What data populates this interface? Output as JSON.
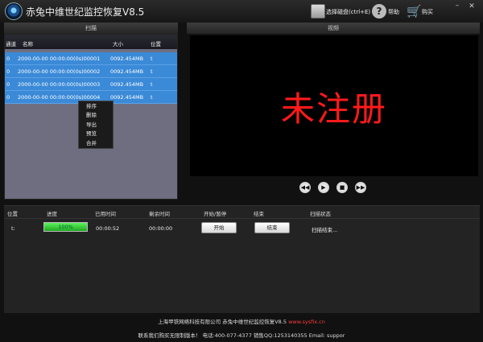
{
  "app": {
    "title": "赤兔中维世纪监控恢复V8.5",
    "select_disk_label": "选择磁盘(ctrl+E)",
    "help_label": "帮助",
    "buy_label": "购买",
    "min_label": "–",
    "close_label": "✕"
  },
  "scan": {
    "header": "扫描",
    "columns": {
      "channel": "通道",
      "name": "名称",
      "size": "大小",
      "location": "位置"
    },
    "rows": [
      {
        "channel": "0",
        "name": "2000-00-00 00:00:00(0s)00001",
        "size": "0092.454MB",
        "location": "t"
      },
      {
        "channel": "0",
        "name": "2000-00-00 00:00:00(0s)00002",
        "size": "0092.454MB",
        "location": "t"
      },
      {
        "channel": "0",
        "name": "2000-00-00 00:00:00(0s)00003",
        "size": "0092.454MB",
        "location": "t"
      },
      {
        "channel": "0",
        "name": "2000-00-00 00:00:00(0s)00004",
        "size": "0092.454MB",
        "location": "t"
      }
    ]
  },
  "context_menu": {
    "items": [
      "排序",
      "删除",
      "导出",
      "预览",
      "合并"
    ]
  },
  "video": {
    "header": "视频",
    "watermark": "未注册",
    "controls": {
      "rewind": "◀◀",
      "play": "▶",
      "stop": "■",
      "forward": "▶▶"
    }
  },
  "task": {
    "columns": {
      "location": "位置",
      "progress": "进度",
      "elapsed": "已用时间",
      "remaining": "剩余时间",
      "start_pause": "开始/暂停",
      "end": "结束",
      "status": "扫描状态"
    },
    "row": {
      "location": "t:",
      "progress": 1.0,
      "progress_text": "100%",
      "elapsed": "00:00:52",
      "remaining": "00:00:00",
      "start_label": "开始",
      "end_label": "结束",
      "status": "扫描结束..."
    }
  },
  "footer": {
    "company": "上海甲铁网络科技有限公司  赤兔中维世纪监控恢复V8.5",
    "website": "www.sysfix.cn",
    "contact": "联系我们购买无限制版本！ 电话:400-077-4377 销售QQ:1253140355 Email: suppor"
  },
  "colors": {
    "row_selected": "#3b8ad8",
    "watermark": "#ff1a1a",
    "progress": "#3cd13c"
  }
}
